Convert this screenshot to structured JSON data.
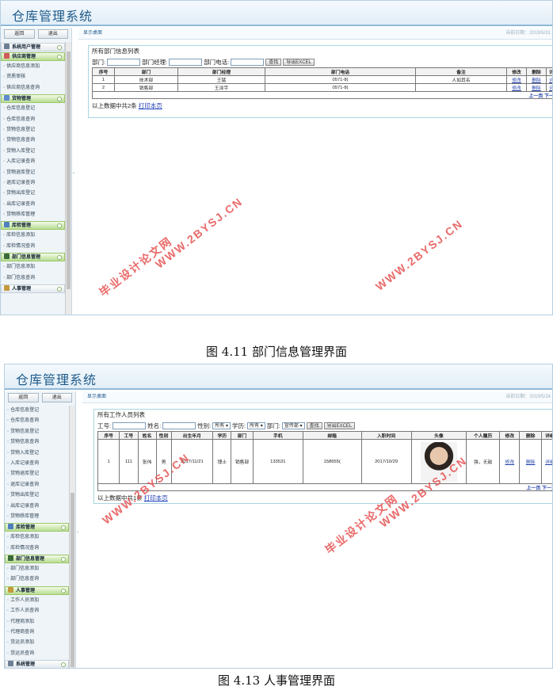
{
  "app_title": "仓库管理系统",
  "sidebar_top": {
    "back": "返回",
    "logout": "退出"
  },
  "breadcrumb": "显示桌面",
  "date_text": "当前日期：2019/5/31",
  "date_text2": "当前日期：2019/5/24",
  "shot1": {
    "sections": [
      {
        "title": "系统用户管理",
        "style": "plain",
        "color": "#6c7f94",
        "items": []
      },
      {
        "title": "供应商管理",
        "style": "green",
        "color": "#d35a5a",
        "items": [
          "供应商信息添加",
          "资质审核",
          "供应商信息查询"
        ]
      },
      {
        "title": "货物管理",
        "style": "green",
        "color": "#5c8ad0",
        "items": [
          "仓库信息登记",
          "仓库信息查询",
          "货物信息登记",
          "货物信息查询",
          "货物入库登记",
          "入库记录查询",
          "货物退库登记",
          "退库记录查询",
          "货物出库登记",
          "出库记录查询",
          "货物移库管理"
        ]
      },
      {
        "title": "库检管理",
        "style": "green",
        "color": "#4f7fc0",
        "items": [
          "库检信息添加",
          "库检情况查询"
        ]
      },
      {
        "title": "部门信息管理",
        "style": "green",
        "color": "#3d6a3a",
        "items": [
          "部门信息添加",
          "部门信息查询"
        ]
      },
      {
        "title": "人事管理",
        "style": "plain",
        "color": "#c49a3d",
        "items": []
      }
    ],
    "panel_title": "所有部门信息列表",
    "filters": {
      "dept": "部门:",
      "manager": "部门经理:",
      "phone": "部门电话:",
      "search": "查找",
      "export": "导出EXCEL"
    },
    "columns": [
      "序号",
      "部门",
      "部门经理",
      "部门电话",
      "备注",
      "修改",
      "删除",
      "详细"
    ],
    "rows": [
      [
        "1",
        "技术部",
        "王猛",
        "0571-8(",
        "人如其名",
        "修改",
        "删除",
        "详细"
      ],
      [
        "2",
        "销售部",
        "王泽宇",
        "0571-8(",
        "",
        "修改",
        "删除",
        "详细"
      ]
    ],
    "pager": "上一页 下一页",
    "summary": "以上数据中共2条",
    "print": "打印本页"
  },
  "shot2": {
    "items_top": [
      "仓库信息登记",
      "仓库信息查询",
      "货物信息登记",
      "货物信息查询",
      "货物入库登记",
      "入库记录查询",
      "货物退库登记",
      "退库记录查询",
      "货物出库登记",
      "出库记录查询",
      "货物移库管理"
    ],
    "sec_check": "库检管理",
    "items_check": [
      "库检信息添加",
      "库检情况查询"
    ],
    "sec_dept": "部门信息管理",
    "items_dept": [
      "部门信息添加",
      "部门信息查询"
    ],
    "sec_hr": "人事管理",
    "items_hr": [
      "工作人员添加",
      "工作人员查询",
      "代理商添加",
      "代理商查询",
      "货运员添加",
      "货运员查询"
    ],
    "sec_sys": "系统管理",
    "panel_title": "所有工作人员列表",
    "filters": {
      "id": "工号:",
      "name": "姓名:",
      "gender": "性别:",
      "gender_val": "所有",
      "edu": "学历:",
      "edu_val": "所有",
      "dept": "部门:",
      "dept_val": "宣传部",
      "search": "查找",
      "export": "导出EXCEL"
    },
    "columns": [
      "序号",
      "工号",
      "姓名",
      "性别",
      "出生年月",
      "学历",
      "部门",
      "手机",
      "邮箱",
      "入职时间",
      "头像",
      "个人履历",
      "修改",
      "删除",
      "详细"
    ],
    "row": [
      "1",
      "111",
      "张伟",
      "男",
      "2017/11/21",
      "博士",
      "销售部",
      "133531",
      "158655(",
      "2017/10/29",
      "",
      "强，无敌",
      "修改",
      "删除",
      "详细"
    ],
    "pager": "上一页 下一页",
    "summary": "以上数据中共1条",
    "print": "打印本页"
  },
  "captions": {
    "fig1": "图 4.11  部门信息管理界面",
    "fig2": "图 4.13  人事管理界面"
  },
  "watermarks": {
    "site": "WWW.2BYSJ.CN",
    "cn": "毕业设计论文网"
  }
}
